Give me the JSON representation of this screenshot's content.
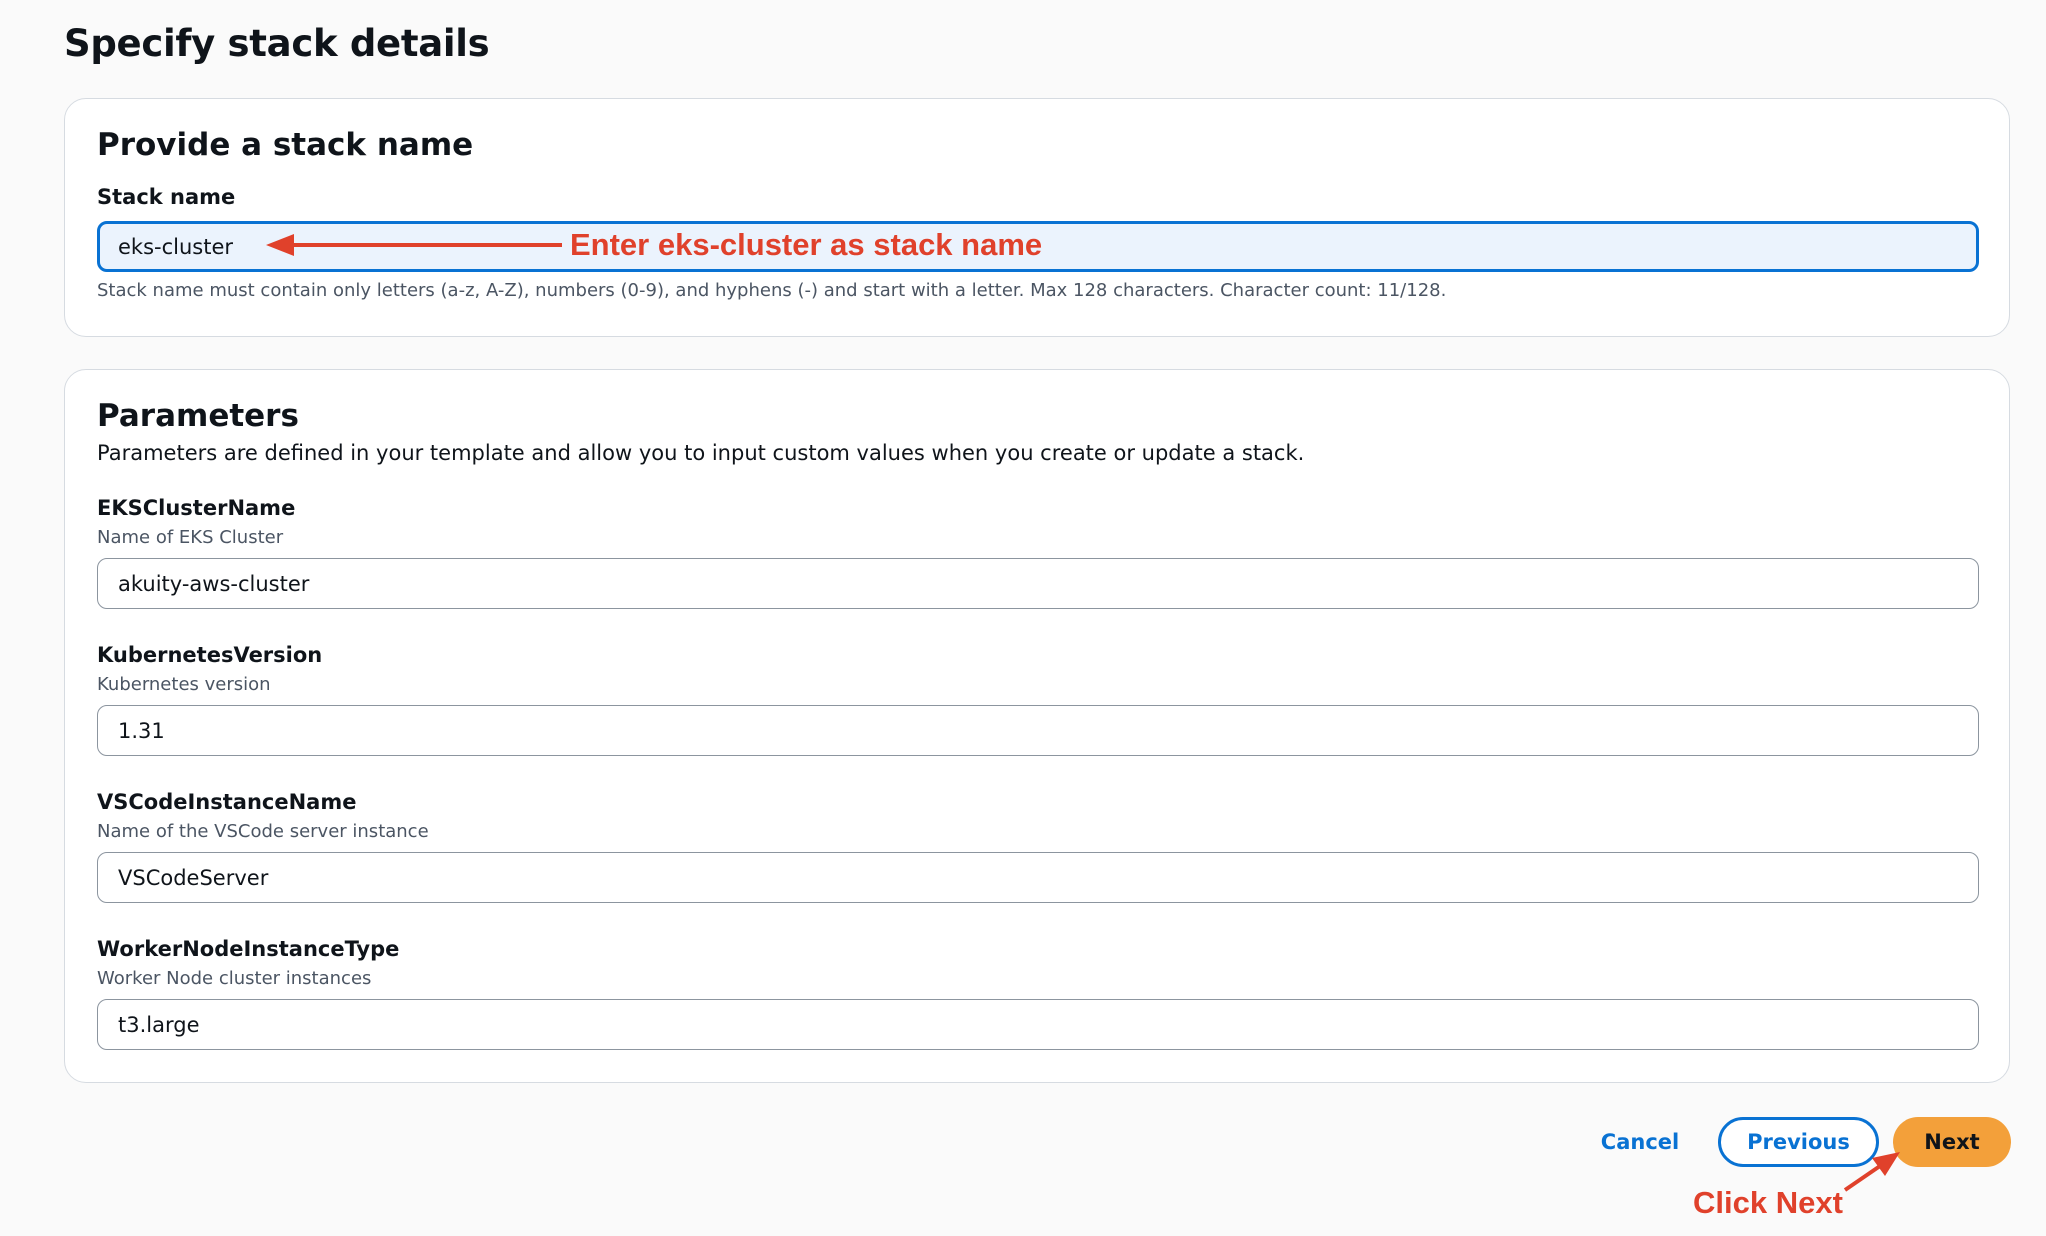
{
  "page": {
    "title": "Specify stack details"
  },
  "stack_section": {
    "heading": "Provide a stack name",
    "label": "Stack name",
    "value": "eks-cluster",
    "constraint": "Stack name must contain only letters (a-z, A-Z), numbers (0-9), and hyphens (-) and start with a letter. Max 128 characters. Character count: 11/128."
  },
  "parameters": {
    "heading": "Parameters",
    "description": "Parameters are defined in your template and allow you to input custom values when you create or update a stack.",
    "fields": [
      {
        "label": "EKSClusterName",
        "description": "Name of EKS Cluster",
        "value": "akuity-aws-cluster"
      },
      {
        "label": "KubernetesVersion",
        "description": "Kubernetes version",
        "value": "1.31"
      },
      {
        "label": "VSCodeInstanceName",
        "description": "Name of the VSCode server instance",
        "value": "VSCodeServer"
      },
      {
        "label": "WorkerNodeInstanceType",
        "description": "Worker Node cluster instances",
        "value": "t3.large"
      }
    ]
  },
  "actions": {
    "cancel": "Cancel",
    "previous": "Previous",
    "next": "Next"
  },
  "annotations": {
    "stack_name_hint": "Enter eks-cluster as stack name",
    "next_hint": "Click Next",
    "color": "#e0412b"
  },
  "colors": {
    "primary": "#0972d3",
    "next_button": "#f3a03a",
    "focus_fill": "#ebf3fd"
  }
}
